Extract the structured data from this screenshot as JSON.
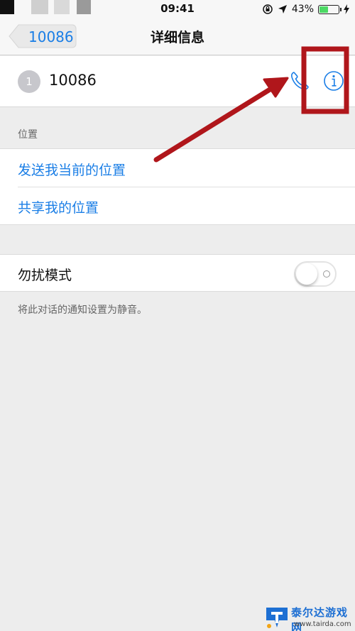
{
  "status_bar": {
    "time": "09:41",
    "battery_percent": "43%",
    "battery_level": 0.43
  },
  "nav": {
    "back_label": "10086",
    "title": "详细信息"
  },
  "contact": {
    "avatar_initial": "1",
    "name": "10086"
  },
  "location_section": {
    "header": "位置",
    "items": [
      {
        "label": "发送我当前的位置"
      },
      {
        "label": "共享我的位置"
      }
    ]
  },
  "dnd": {
    "label": "勿扰模式",
    "enabled": false,
    "footer": "将此对话的通知设置为静音。"
  },
  "colors": {
    "accent": "#1a7ee6",
    "annotation": "#b0161b",
    "background": "#ededed"
  },
  "watermark": {
    "name": "泰尔达游戏网",
    "url": "www.tairda.com"
  }
}
